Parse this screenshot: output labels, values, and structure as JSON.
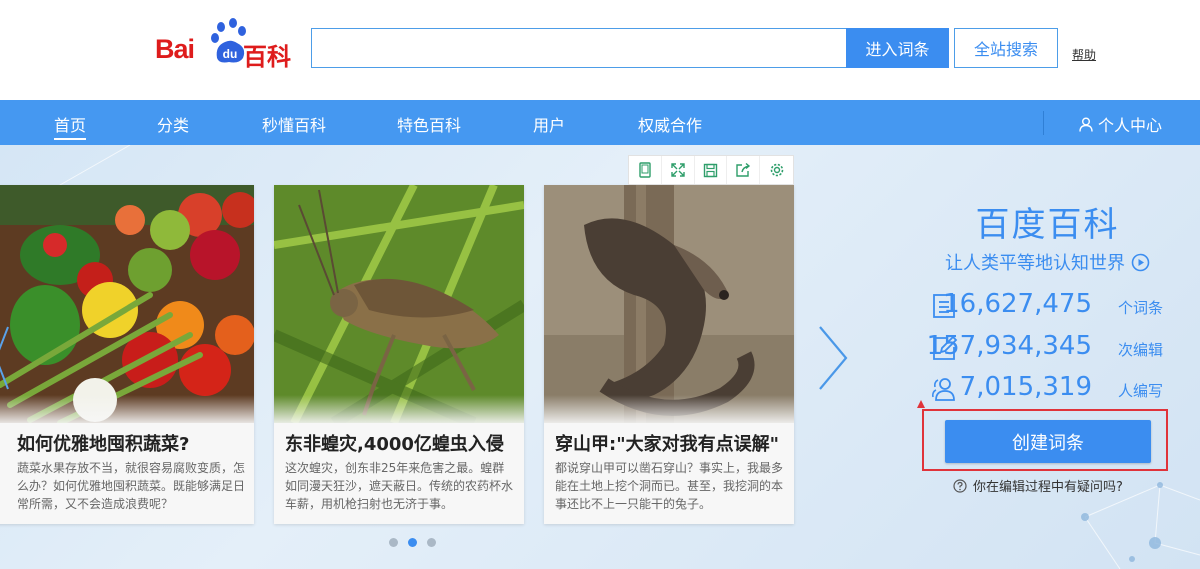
{
  "logo": {
    "bai": "Bai",
    "du": "du",
    "baike": "百科"
  },
  "search": {
    "value": "",
    "placeholder": "",
    "enter_label": "进入词条",
    "site_search_label": "全站搜索",
    "help_label": "帮助"
  },
  "nav": {
    "items": [
      {
        "label": "首页",
        "active": true
      },
      {
        "label": "分类"
      },
      {
        "label": "秒懂百科"
      },
      {
        "label": "特色百科"
      },
      {
        "label": "用户"
      },
      {
        "label": "权威合作"
      }
    ],
    "user_center": "个人中心"
  },
  "carousel": {
    "cards": [
      {
        "title": "如何优雅地囤积蔬菜?",
        "desc": "蔬菜水果存放不当，就很容易腐败变质，怎么办？如何优雅地囤积蔬菜。既能够满足日常所需，又不会造成浪费呢？",
        "image": "vegetables"
      },
      {
        "title": "东非蝗灾,4000亿蝗虫入侵",
        "desc": "这次蝗灾，创东非25年来危害之最。蝗群如同漫天狂沙，遮天蔽日。传统的农药杯水车薪，用机枪扫射也无济于事。",
        "image": "locust"
      },
      {
        "title": "穿山甲:\"大家对我有点误解\"",
        "desc": "都说穿山甲可以凿石穿山？事实上，我最多能在土地上挖个洞而已。甚至，我挖洞的本事还比不上一只能干的兔子。",
        "image": "pangolin"
      }
    ],
    "toolbar_icons": [
      "tablet-icon",
      "fullscreen-icon",
      "save-icon",
      "share-icon",
      "settings-icon"
    ],
    "dots": 3,
    "active_dot": 2
  },
  "panel": {
    "title": "百度百科",
    "slogan": "让人类平等地认知世界",
    "stats": [
      {
        "icon": "document-list-icon",
        "value": "16,627,475",
        "unit": "个词条"
      },
      {
        "icon": "edit-icon",
        "value": "157,934,345",
        "unit": "次编辑"
      },
      {
        "icon": "users-icon",
        "value": "7,015,319",
        "unit": "人编写"
      }
    ],
    "create_label": "创建词条",
    "question": "你在编辑过程中有疑问吗?"
  },
  "colors": {
    "accent": "#3b8df0",
    "nav": "#4598f1",
    "logo_red": "#de1c1c",
    "highlight": "#e0333a"
  }
}
